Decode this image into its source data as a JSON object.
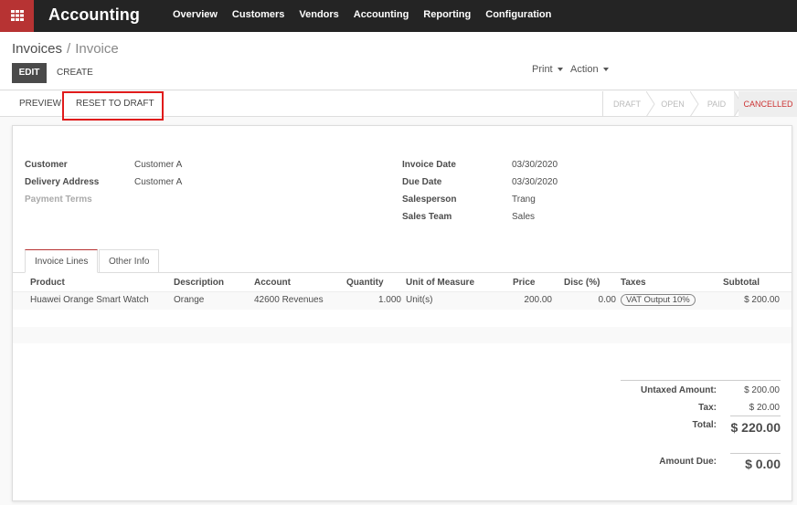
{
  "app": {
    "title": "Accounting",
    "menu": [
      "Overview",
      "Customers",
      "Vendors",
      "Accounting",
      "Reporting",
      "Configuration"
    ]
  },
  "breadcrumb": {
    "parent": "Invoices",
    "separator": "/",
    "current": "Invoice"
  },
  "toolbar": {
    "edit_label": "EDIT",
    "create_label": "CREATE",
    "print_label": "Print",
    "action_label": "Action"
  },
  "statusbar": {
    "preview_label": "PREVIEW",
    "reset_label": "RESET TO DRAFT",
    "stages": [
      "DRAFT",
      "OPEN",
      "PAID",
      "CANCELLED"
    ],
    "current_stage": "CANCELLED"
  },
  "form": {
    "left": [
      {
        "label": "Customer",
        "value": "Customer A"
      },
      {
        "label": "Delivery Address",
        "value": "Customer A"
      },
      {
        "label": "Payment Terms",
        "value": ""
      }
    ],
    "right": [
      {
        "label": "Invoice Date",
        "value": "03/30/2020"
      },
      {
        "label": "Due Date",
        "value": "03/30/2020"
      },
      {
        "label": "Salesperson",
        "value": "Trang"
      },
      {
        "label": "Sales Team",
        "value": "Sales"
      }
    ]
  },
  "tabs": [
    "Invoice Lines",
    "Other Info"
  ],
  "lines": {
    "columns": [
      "Product",
      "Description",
      "Account",
      "Quantity",
      "Unit of Measure",
      "Price",
      "Disc (%)",
      "Taxes",
      "Subtotal"
    ],
    "rows": [
      {
        "product": "Huawei Orange Smart Watch",
        "description": "Orange",
        "account": "42600 Revenues",
        "quantity": "1.000",
        "uom": "Unit(s)",
        "price": "200.00",
        "discount": "0.00",
        "tax": "VAT Output 10%",
        "subtotal": "$ 200.00"
      }
    ]
  },
  "totals": {
    "untaxed_label": "Untaxed Amount:",
    "untaxed_value": "$ 200.00",
    "tax_label": "Tax:",
    "tax_value": "$ 20.00",
    "total_label": "Total:",
    "total_value": "$ 220.00",
    "due_label": "Amount Due:",
    "due_value": "$ 0.00"
  },
  "colors": {
    "brand": "#b73333",
    "navbar": "#242424",
    "highlight": "#e01b1b",
    "cancelled": "#cc3333"
  }
}
